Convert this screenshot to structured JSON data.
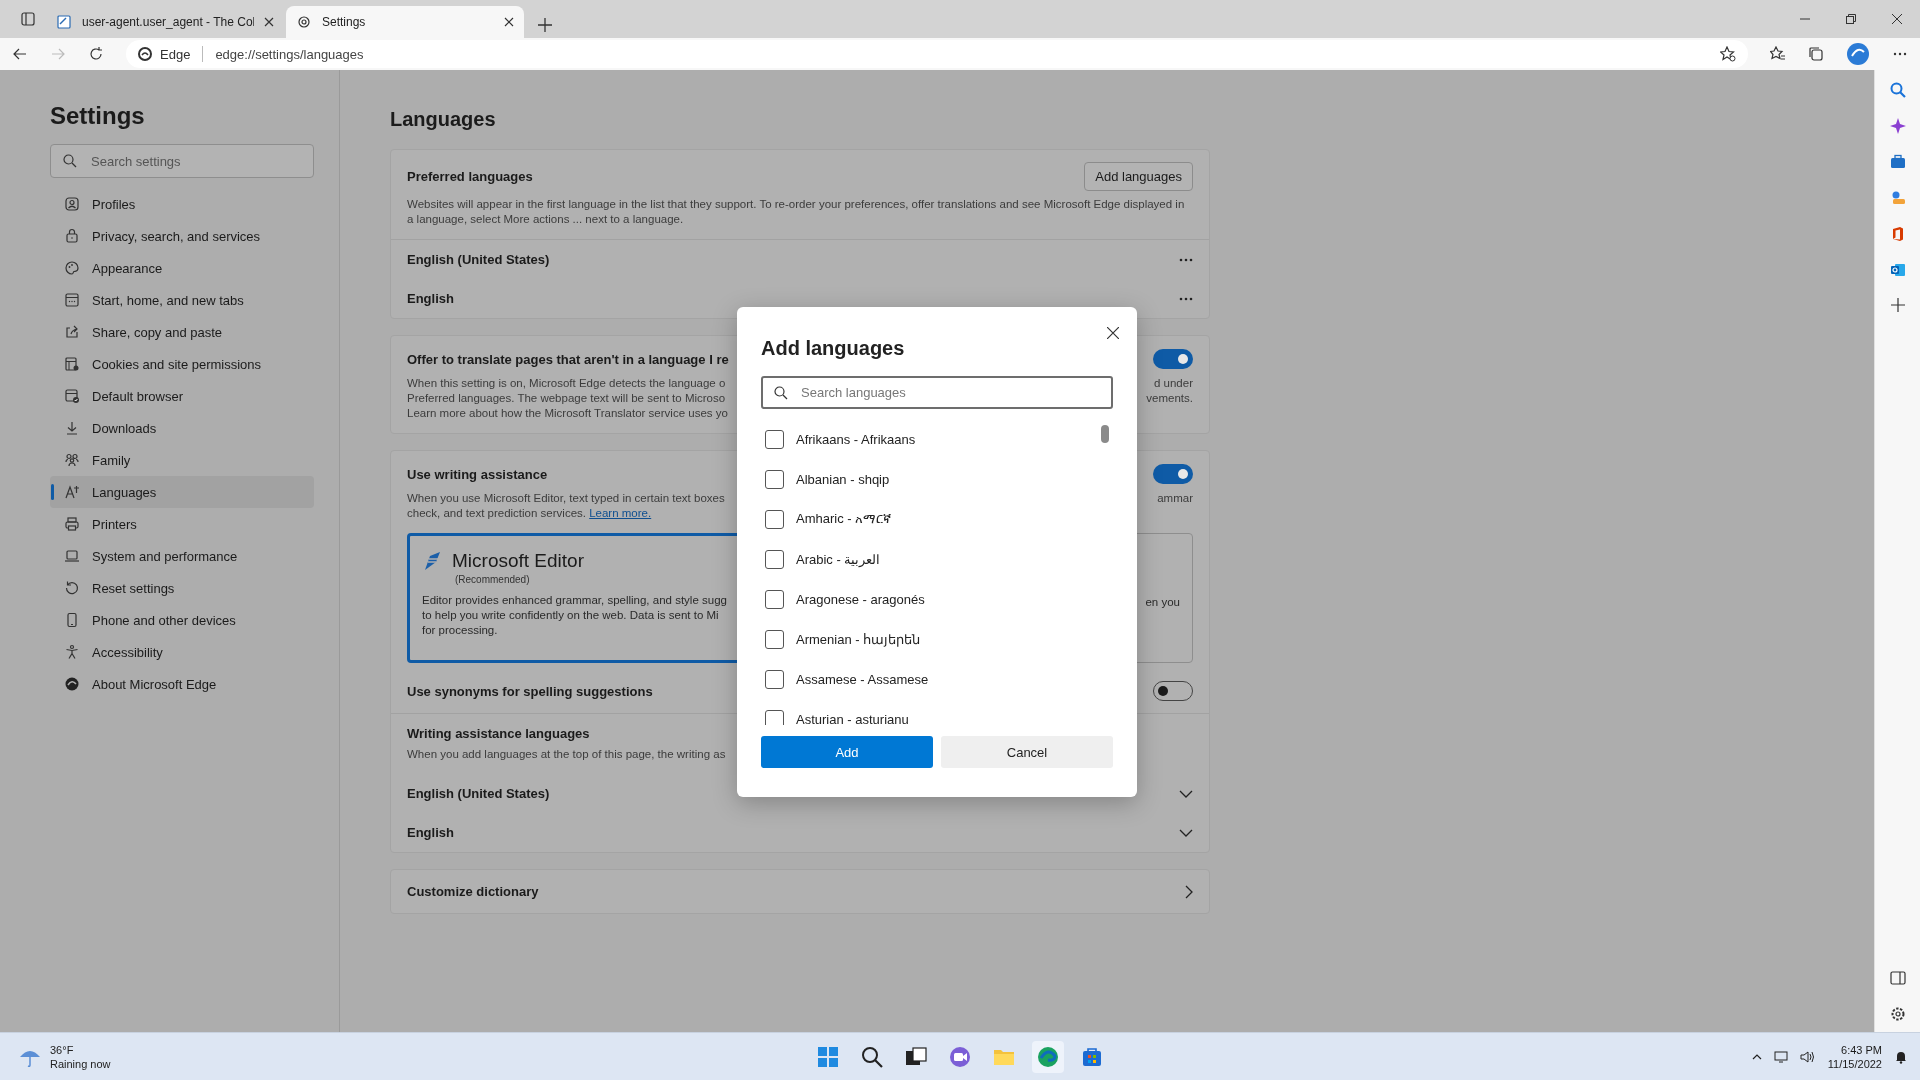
{
  "browser": {
    "tabs": [
      {
        "title": "user-agent.user_agent - The Col",
        "selected": false
      },
      {
        "title": "Settings",
        "selected": true
      }
    ],
    "address_bar": {
      "site_label": "Edge",
      "url": "edge://settings/languages"
    }
  },
  "sidebar": {
    "title": "Settings",
    "search": {
      "placeholder": "Search settings"
    },
    "items": [
      {
        "label": "Profiles",
        "selected": false
      },
      {
        "label": "Privacy, search, and services",
        "selected": false
      },
      {
        "label": "Appearance",
        "selected": false
      },
      {
        "label": "Start, home, and new tabs",
        "selected": false
      },
      {
        "label": "Share, copy and paste",
        "selected": false
      },
      {
        "label": "Cookies and site permissions",
        "selected": false
      },
      {
        "label": "Default browser",
        "selected": false
      },
      {
        "label": "Downloads",
        "selected": false
      },
      {
        "label": "Family",
        "selected": false
      },
      {
        "label": "Languages",
        "selected": true
      },
      {
        "label": "Printers",
        "selected": false
      },
      {
        "label": "System and performance",
        "selected": false
      },
      {
        "label": "Reset settings",
        "selected": false
      },
      {
        "label": "Phone and other devices",
        "selected": false
      },
      {
        "label": "Accessibility",
        "selected": false
      },
      {
        "label": "About Microsoft Edge",
        "selected": false
      }
    ]
  },
  "page": {
    "title": "Languages",
    "preferred": {
      "title": "Preferred languages",
      "button": "Add languages",
      "description": "Websites will appear in the first language in the list that they support. To re-order your preferences, offer translations and see Microsoft Edge displayed in a language, select More actions ... next to a language.",
      "languages": [
        "English (United States)",
        "English"
      ]
    },
    "translate": {
      "title": "Offer to translate pages that aren't in a language I re",
      "on": true,
      "lines": [
        {
          "left": "When this setting is on, Microsoft Edge detects the language o",
          "right": "d under"
        },
        {
          "left": "Preferred languages. The webpage text will be sent to Microso",
          "right": "vements."
        },
        {
          "left": "Learn more about how the Microsoft Translator service uses yo"
        }
      ]
    },
    "writing": {
      "title": "Use writing assistance",
      "on": true,
      "lines": [
        {
          "left": "When you use Microsoft Editor, text typed in certain text boxes",
          "right": "ammar"
        },
        {
          "left": "check, and text prediction services.",
          "link": "Learn more."
        }
      ],
      "options": [
        {
          "name": "Microsoft Editor",
          "note": "(Recommended)",
          "selected": true,
          "lines": [
            "Editor provides enhanced grammar, spelling, and style sugg",
            "to help you write confidently on the web. Data is sent to Mi",
            "for processing."
          ]
        },
        {
          "selected": false,
          "lines": [
            "en you"
          ]
        }
      ],
      "synonyms": {
        "label": "Use synonyms for spelling suggestions",
        "on": false
      },
      "languages_title": "Writing assistance languages",
      "languages_description": "When you add languages at the top of this page, the writing as",
      "languages": [
        "English (United States)",
        "English"
      ]
    },
    "dictionary": {
      "label": "Customize dictionary"
    }
  },
  "dialog": {
    "title": "Add languages",
    "search": {
      "placeholder": "Search languages"
    },
    "languages": [
      {
        "label": "Afrikaans - Afrikaans",
        "checked": false
      },
      {
        "label": "Albanian - shqip",
        "checked": false
      },
      {
        "label": "Amharic - አማርኛ",
        "checked": false
      },
      {
        "label": "Arabic - العربية",
        "checked": false
      },
      {
        "label": "Aragonese - aragonés",
        "checked": false
      },
      {
        "label": "Armenian - հայերեն",
        "checked": false
      },
      {
        "label": "Assamese - Assamese",
        "checked": false
      },
      {
        "label": "Asturian - asturianu",
        "checked": false
      }
    ],
    "buttons": {
      "confirm": "Add",
      "cancel": "Cancel"
    }
  },
  "taskbar": {
    "weather": {
      "temperature": "36°F",
      "condition": "Raining now"
    },
    "clock": {
      "time": "6:43 PM",
      "date": "11/15/2022"
    }
  }
}
